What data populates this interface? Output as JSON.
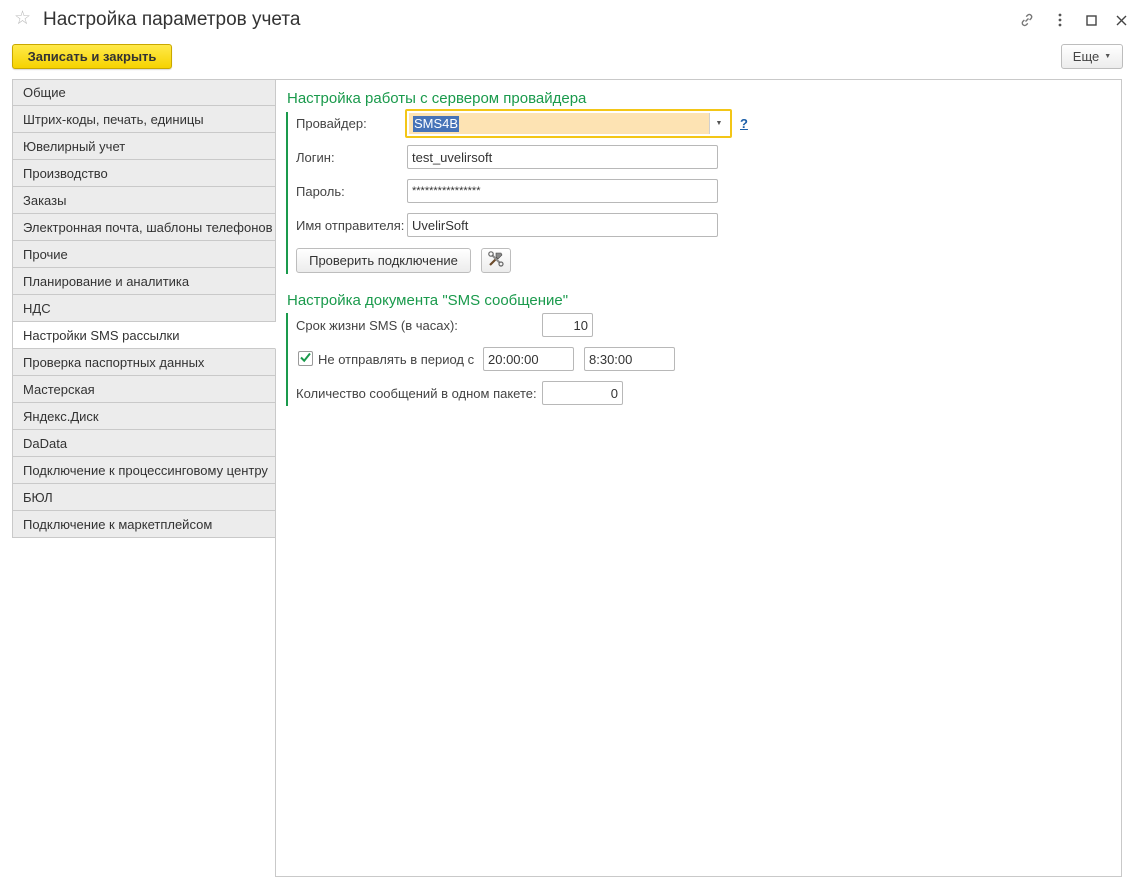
{
  "window": {
    "title": "Настройка параметров учета",
    "star_icon": "star-icon",
    "link_icon": "link-icon",
    "more_icon": "kebab-menu-icon",
    "maximize_icon": "maximize-icon",
    "close_icon": "close-icon"
  },
  "toolbar": {
    "save_close_label": "Записать и закрыть",
    "more_label": "Еще",
    "accent_color": "#f6d300"
  },
  "sidebar": {
    "items": [
      {
        "label": "Общие",
        "active": false
      },
      {
        "label": "Штрих-коды, печать, единицы",
        "active": false
      },
      {
        "label": "Ювелирный учет",
        "active": false
      },
      {
        "label": "Производство",
        "active": false
      },
      {
        "label": "Заказы",
        "active": false
      },
      {
        "label": "Электронная почта, шаблоны телефонов",
        "active": false
      },
      {
        "label": "Прочие",
        "active": false
      },
      {
        "label": "Планирование и аналитика",
        "active": false
      },
      {
        "label": "НДС",
        "active": false
      },
      {
        "label": "Настройки SMS рассылки",
        "active": true
      },
      {
        "label": "Проверка паспортных данных",
        "active": false
      },
      {
        "label": "Мастерская",
        "active": false
      },
      {
        "label": "Яндекс.Диск",
        "active": false
      },
      {
        "label": "DaData",
        "active": false
      },
      {
        "label": "Подключение к процессинговому центру",
        "active": false
      },
      {
        "label": "БЮЛ",
        "active": false
      },
      {
        "label": "Подключение к маркетплейсом",
        "active": false
      }
    ]
  },
  "provider_section": {
    "title": "Настройка работы с сервером провайдера",
    "color": "#1a9a4c",
    "provider_label": "Провайдер:",
    "provider_value": "SMS4B",
    "help_label": "?",
    "login_label": "Логин:",
    "login_value": "test_uvelirsoft",
    "password_label": "Пароль:",
    "password_value": "****************",
    "sender_label": "Имя отправителя:",
    "sender_value": "UvelirSoft",
    "check_button_label": "Проверить подключение",
    "tools_icon": "hammer-wrench-icon"
  },
  "sms_section": {
    "title": "Настройка документа \"SMS сообщение\"",
    "lifetime_label": "Срок жизни SMS (в часах):",
    "lifetime_value": "10",
    "dont_send_label": "Не отправлять в период с",
    "dont_send_checked": true,
    "period_from": "20:00:00",
    "period_to": "8:30:00",
    "batch_label": "Количество сообщений в одном пакете:",
    "batch_value": "0"
  }
}
